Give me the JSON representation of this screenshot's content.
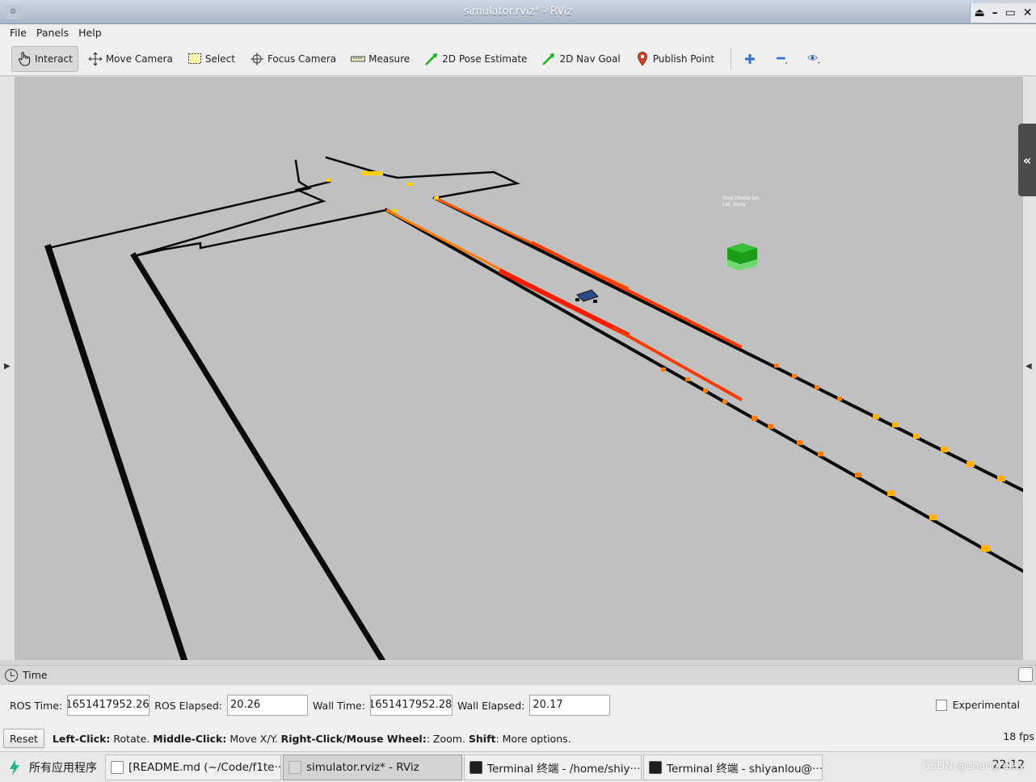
{
  "window": {
    "title": "simulator.rviz* - RViz",
    "controls": [
      "⏏",
      "–",
      "▭",
      "✕"
    ]
  },
  "menu": [
    "File",
    "Panels",
    "Help"
  ],
  "toolbar": {
    "interact": "Interact",
    "move_camera": "Move Camera",
    "select": "Select",
    "focus_camera": "Focus Camera",
    "measure": "Measure",
    "pose_estimate": "2D Pose Estimate",
    "nav_goal": "2D Nav Goal",
    "publish_point": "Publish Point"
  },
  "viewport": {
    "background": "#c0c0c0",
    "marker_text_line1": "Goal Obstacles",
    "marker_text_line2": "Lat. Deny",
    "colors": {
      "wall": "#0a0a0a",
      "scan_red": "#ff1a00",
      "scan_orange": "#ff7a00",
      "scan_yellow": "#ffd000",
      "box_green": "#1a9e1a",
      "car_blue": "#2a4a8a"
    }
  },
  "time_panel": {
    "title": "Time",
    "ros_time_label": "ROS Time:",
    "ros_time": "1651417952.26",
    "ros_elapsed_label": "ROS Elapsed:",
    "ros_elapsed": "20.26",
    "wall_time_label": "Wall Time:",
    "wall_time": "1651417952.28",
    "wall_elapsed_label": "Wall Elapsed:",
    "wall_elapsed": "20.17",
    "experimental_label": "Experimental"
  },
  "status": {
    "reset": "Reset",
    "left_click_key": "Left-Click:",
    "left_click_val": " Rotate. ",
    "middle_click_key": "Middle-Click:",
    "middle_click_val": " Move X/Y. ",
    "right_click_key": "Right-Click/Mouse Wheel:",
    "right_click_val": ": Zoom. ",
    "shift_key": "Shift",
    "shift_val": ": More options.",
    "fps": "18 fps"
  },
  "taskbar": {
    "start": "所有应用程序",
    "tasks": [
      "[README.md (~/Code/f1te···",
      "simulator.rviz* - RViz",
      "Terminal 终端 - /home/shiy···",
      "Terminal 终端 - shiyanlou@···"
    ],
    "clock": "22:12",
    "watermark": "CSDN @zhangrelay"
  }
}
